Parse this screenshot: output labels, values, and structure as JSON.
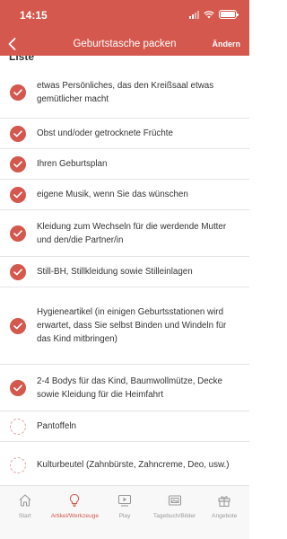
{
  "status_bar": {
    "time": "14:15"
  },
  "navbar": {
    "title": "Geburtstasche packen",
    "edit_label": "Ändern"
  },
  "section": {
    "title": "Liste"
  },
  "items": [
    {
      "text": "etwas Persönliches, das den Kreißsaal etwas gemütlicher macht",
      "checked": true
    },
    {
      "text": "Obst und/oder getrocknete Früchte",
      "checked": true
    },
    {
      "text": "Ihren Geburtsplan",
      "checked": true
    },
    {
      "text": "eigene Musik, wenn Sie das wünschen",
      "checked": true
    },
    {
      "text": "Kleidung zum Wechseln für die werdende Mutter und den/die Partner/in",
      "checked": true
    },
    {
      "text": "Still-BH, Stillkleidung sowie Stilleinlagen",
      "checked": true
    },
    {
      "text": "Hygieneartikel (in einigen Geburtsstationen wird erwartet, dass Sie selbst Binden und Windeln für das Kind mitbringen)",
      "checked": true
    },
    {
      "text": "2-4 Bodys für das Kind, Baumwollmütze, Decke sowie Kleidung für die Heimfahrt",
      "checked": true
    },
    {
      "text": "Pantoffeln",
      "checked": false
    },
    {
      "text": "Kulturbeutel (Zahnbürste, Zahncreme, Deo, usw.)",
      "checked": false
    }
  ],
  "tabs": [
    {
      "label": "Start",
      "icon": "home-icon",
      "active": false
    },
    {
      "label": "Artikel/Werkzeuge",
      "icon": "lightbulb-icon",
      "active": true
    },
    {
      "label": "Play",
      "icon": "play-icon",
      "active": false
    },
    {
      "label": "Tagebuch/Bilder",
      "icon": "photo-album-icon",
      "active": false
    },
    {
      "label": "Angebote",
      "icon": "gift-icon",
      "active": false
    }
  ],
  "colors": {
    "accent": "#d4584d",
    "inactive": "#9a9a9a"
  }
}
